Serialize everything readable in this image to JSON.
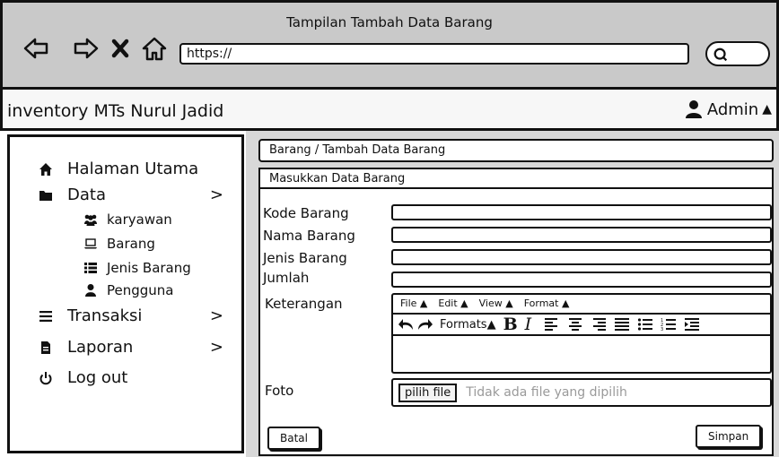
{
  "window": {
    "title": "Tampilan Tambah Data Barang"
  },
  "browser": {
    "url": "https://",
    "icons": [
      "back-arrow-icon",
      "forward-arrow-icon",
      "close-icon",
      "home-icon",
      "search-icon"
    ]
  },
  "app": {
    "title": "inventory MTs Nurul Jadid",
    "user": "Admin"
  },
  "sidebar": {
    "items": [
      {
        "label": "Halaman Utama",
        "icon": "home-icon"
      },
      {
        "label": "Data",
        "icon": "folder-icon",
        "chevron": ">"
      },
      {
        "label": "karyawan",
        "icon": "users-icon"
      },
      {
        "label": "Barang",
        "icon": "laptop-icon"
      },
      {
        "label": "Jenis Barang",
        "icon": "list-icon"
      },
      {
        "label": "Pengguna",
        "icon": "user-icon"
      },
      {
        "label": "Transaksi",
        "icon": "menu-icon",
        "chevron": ">"
      },
      {
        "label": "Laporan",
        "icon": "file-icon",
        "chevron": ">"
      },
      {
        "label": "Log out",
        "icon": "power-icon"
      }
    ]
  },
  "breadcrumb": "Barang / Tambah Data Barang",
  "form": {
    "heading": "Masukkan Data Barang",
    "fields": {
      "kode": "Kode Barang",
      "nama": "Nama Barang",
      "jenis": "Jenis Barang",
      "jumlah": "Jumlah",
      "keterangan": "Keterangan",
      "foto": "Foto"
    },
    "editor": {
      "menu": [
        "File ▲",
        "Edit ▲",
        "View ▲",
        "Format ▲"
      ],
      "formats": "Formats▲"
    },
    "file": {
      "button": "pilih file",
      "status": "Tidak ada file yang dipilih"
    },
    "buttons": {
      "batal": "Batal",
      "simpan": "Simpan"
    }
  }
}
